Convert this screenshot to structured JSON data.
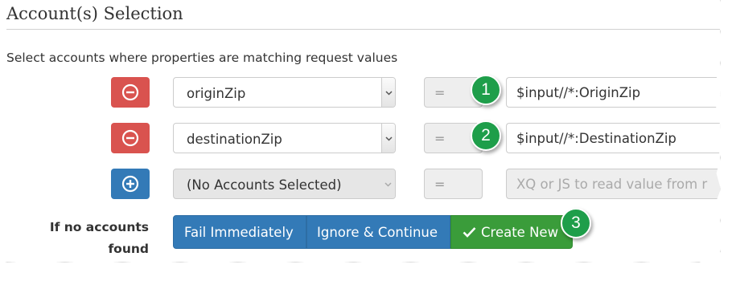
{
  "section": {
    "title": "Account(s) Selection",
    "description": "Select accounts where properties are matching request values"
  },
  "rows": [
    {
      "action": "remove",
      "property": "originZip",
      "operator": "=",
      "value": "$input//*:OriginZip",
      "callout": "1"
    },
    {
      "action": "remove",
      "property": "destinationZip",
      "operator": "=",
      "value": "$input//*:DestinationZip",
      "callout": "2"
    },
    {
      "action": "add",
      "property": "(No Accounts Selected)",
      "operator": "=",
      "placeholder": "XQ or JS to read value from r"
    }
  ],
  "no_accounts": {
    "label_line1": "If no accounts",
    "label_line2": "found",
    "options": [
      {
        "label": "Fail Immediately",
        "selected": false
      },
      {
        "label": "Ignore & Continue",
        "selected": false
      },
      {
        "label": "Create New",
        "selected": true
      }
    ],
    "callout": "3"
  },
  "colors": {
    "remove_button": "#d9534f",
    "add_button": "#337ab7",
    "primary": "#337ab7",
    "success": "#3a9c3a",
    "callout": "#1e9e4a"
  },
  "icons": {
    "remove": "minus-circle-icon",
    "add": "plus-circle-icon",
    "select_arrow": "chevron-updown-icon",
    "selected": "check-icon"
  }
}
